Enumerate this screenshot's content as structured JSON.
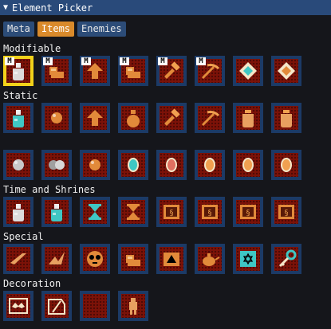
{
  "window": {
    "title": "Element Picker",
    "collapse_icon": "triangle-down"
  },
  "tabs": [
    {
      "label": "Meta",
      "active": false
    },
    {
      "label": "Items",
      "active": true
    },
    {
      "label": "Enemies",
      "active": false
    }
  ],
  "sections": [
    {
      "label": "Modifiable",
      "items": [
        "potion-modifiable",
        "arm-modifiable",
        "tree-modifiable",
        "arm-bag-modifiable",
        "hammer-modifiable",
        "pickaxe-modifiable",
        "crystal-diamond-modifiable",
        "gem-diamond-modifiable"
      ]
    },
    {
      "label": "Static",
      "items": [
        "blue-potion",
        "orange-orb",
        "tree",
        "flask",
        "hammer",
        "pickaxe",
        "jar",
        "vase"
      ]
    },
    {
      "label": "",
      "items": [
        "gray-ball",
        "silver-balls",
        "orange-ball",
        "cyan-coin",
        "red-coin",
        "gold-coin",
        "gold-coin-large",
        "gold-coin-round"
      ]
    },
    {
      "label": "Time and Shrines",
      "items": [
        "empty-bottle",
        "cyan-bottle",
        "hourglass-blue",
        "hourglass-brown",
        "shrine-leo",
        "shrine-virgo",
        "shrine-libra",
        "shrine-scorpio"
      ]
    },
    {
      "label": "Special",
      "items": [
        "scroll",
        "crane",
        "mask",
        "armor",
        "triangle-block",
        "teapot",
        "hexagram-tablet",
        "key"
      ]
    },
    {
      "label": "Decoration",
      "items": [
        "bat-frame",
        "broken-frame",
        "blank-tile",
        "figure"
      ]
    }
  ],
  "colors": {
    "title_bar": "#294a7a",
    "tab": "#2c4c78",
    "tab_active": "#d98a2b",
    "slot_border": "#1c3a66",
    "slot_selected": "#f2d21a",
    "tile": "#7c1208"
  }
}
